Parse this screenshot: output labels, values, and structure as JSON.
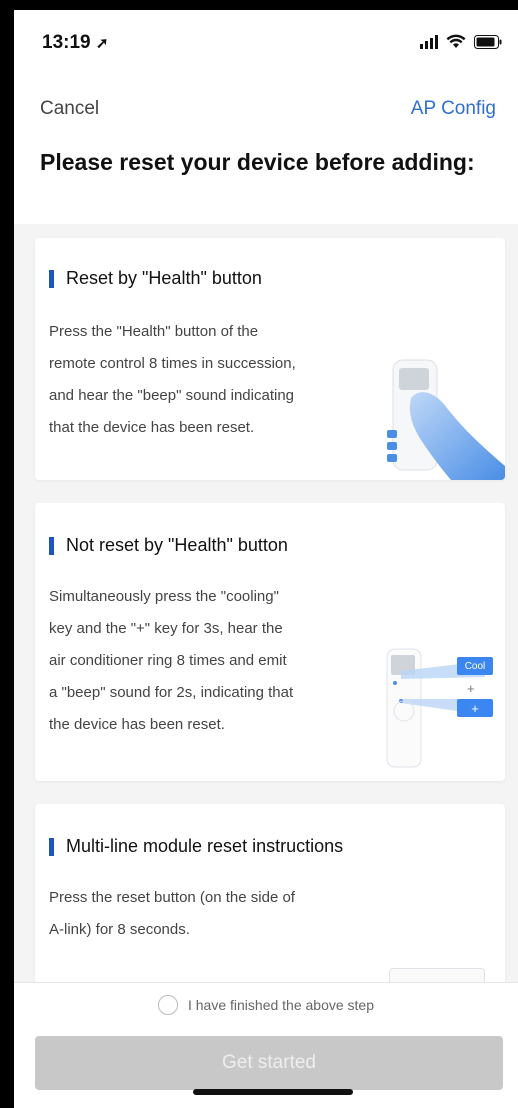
{
  "status_bar": {
    "time": "13:19"
  },
  "nav": {
    "cancel_label": "Cancel",
    "right_label": "AP Config"
  },
  "page": {
    "title": "Please reset your device before adding:"
  },
  "cards": [
    {
      "title": "Reset by \"Health\" button",
      "lines": [
        "Press the \"Health\" button of the",
        "remote control 8 times in succession,",
        "and hear the \"beep\" sound indicating",
        "that the device has been reset."
      ]
    },
    {
      "title": "Not reset by \"Health\" button",
      "lines": [
        "Simultaneously press the \"cooling\"",
        "key and the \"+\" key for 3s, hear the",
        "air conditioner ring 8 times and emit",
        "a \"beep\" sound for 2s, indicating that",
        "the device has been reset."
      ],
      "illustration": {
        "cool_label": "Cool",
        "plus_label": "+",
        "plus_small": "+"
      }
    },
    {
      "title": "Multi-line module reset instructions",
      "lines": [
        "Press the reset button (on the side of",
        "A-link) for 8 seconds."
      ]
    }
  ],
  "footer": {
    "confirm_label": "I have finished the above step",
    "button_label": "Get started"
  },
  "colors": {
    "accent": "#2f6fd1",
    "bar": "#1f53c2",
    "disabled_button": "#c8c8c8"
  }
}
